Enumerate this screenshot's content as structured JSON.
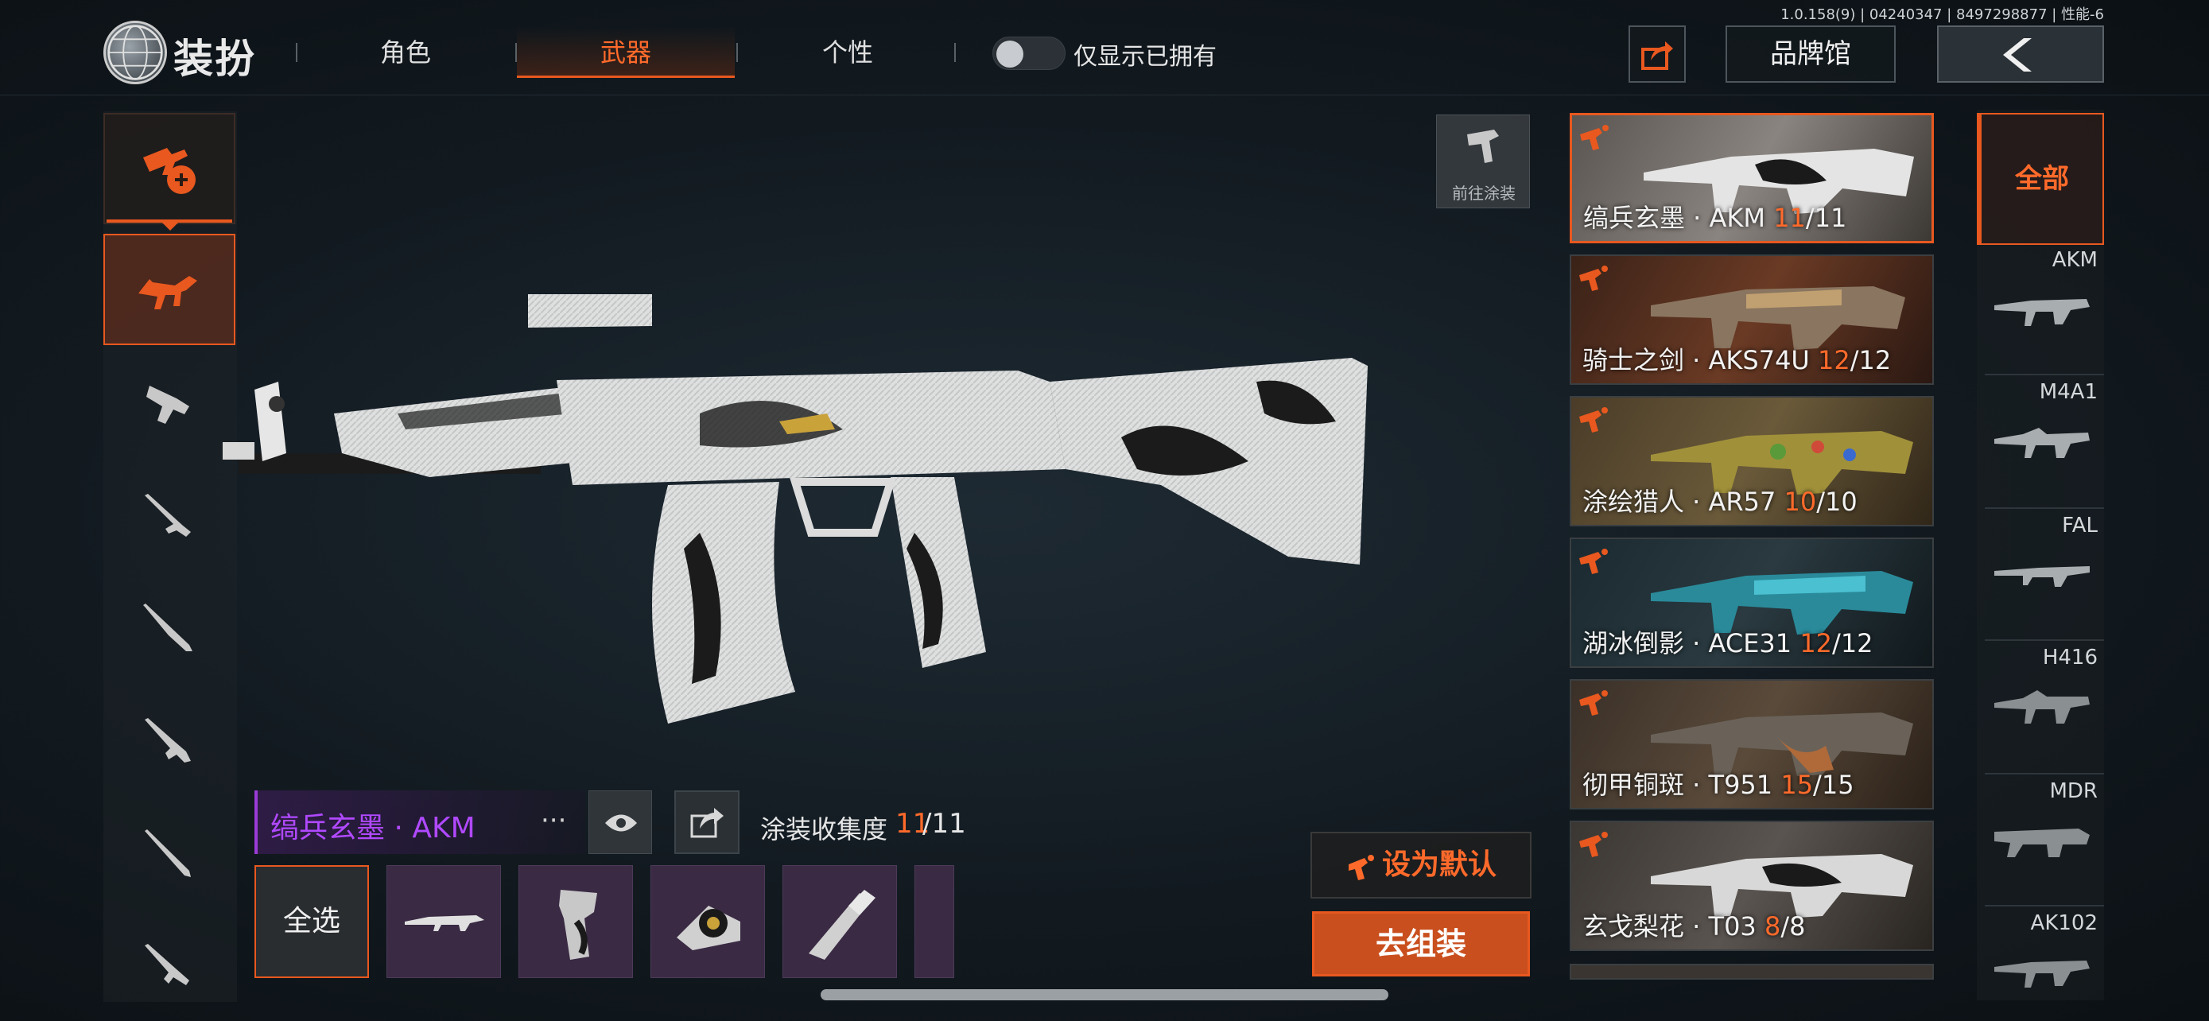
{
  "build_info": "1.0.158(9) | 04240347 | 8497298877 | 性能-6",
  "header": {
    "title": "装扮",
    "tabs": [
      "角色",
      "武器",
      "个性"
    ],
    "active_tab": "武器",
    "owned_only_label": "仅显示已拥有",
    "brand_hall_label": "品牌馆"
  },
  "paint_shortcut": {
    "label": "前往涂装"
  },
  "skin_list": [
    {
      "name": "缟兵玄墨 · AKM ",
      "owned": "11",
      "total": "/11",
      "active": true
    },
    {
      "name": "骑士之剑 · AKS74U ",
      "owned": "12",
      "total": "/12"
    },
    {
      "name": "涂绘猎人 · AR57 ",
      "owned": "10",
      "total": "/10"
    },
    {
      "name": "湖冰倒影 · ACE31 ",
      "owned": "12",
      "total": "/12"
    },
    {
      "name": "彻甲铜斑 · T951 ",
      "owned": "15",
      "total": "/15"
    },
    {
      "name": "玄戈梨花 · T03 ",
      "owned": "8",
      "total": "/8"
    }
  ],
  "weapon_filter": {
    "all_label": "全部",
    "items": [
      "AKM",
      "M4A1",
      "FAL",
      "H416",
      "MDR",
      "AK102"
    ]
  },
  "selected_skin": {
    "name": "缟兵玄墨 · AKM",
    "more": "···",
    "collection_label": "涂装收集度",
    "collection_owned": "11",
    "collection_total": "/11"
  },
  "parts": {
    "select_all_label": "全选"
  },
  "actions": {
    "set_default_label": "设为默认",
    "assemble_label": "去组装"
  },
  "colors": {
    "accent": "#e8581f",
    "rarity_purple": "#b049ff"
  }
}
